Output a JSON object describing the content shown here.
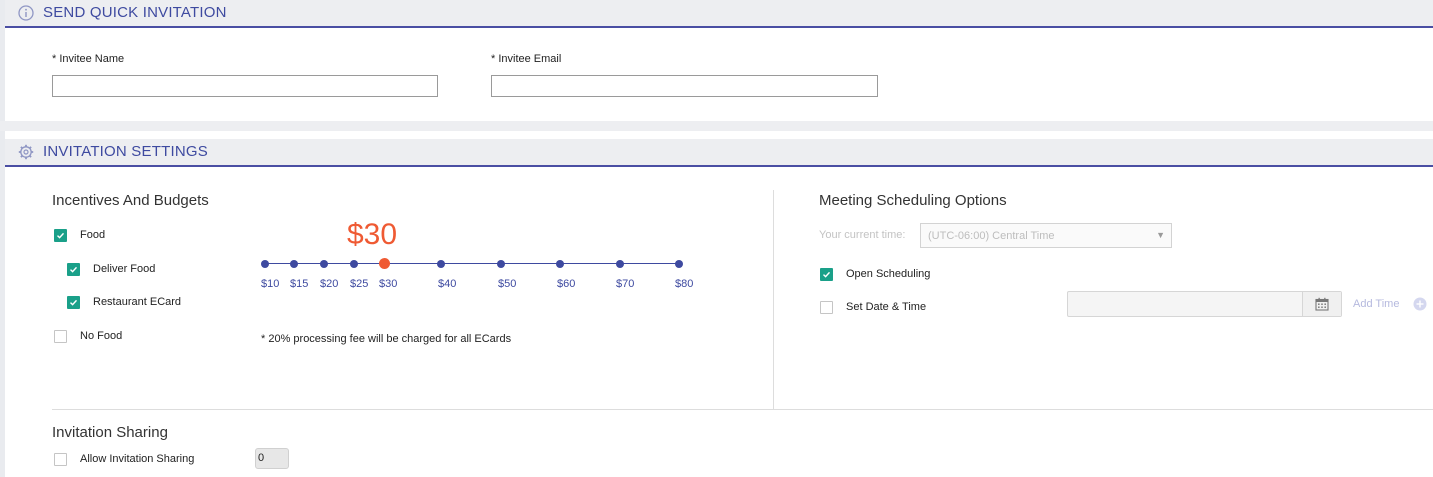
{
  "quick_invitation": {
    "title": "SEND QUICK INVITATION",
    "icon": "info-icon",
    "invitee_name_label": "* Invitee Name",
    "invitee_name_value": "",
    "invitee_email_label": "* Invitee Email",
    "invitee_email_value": ""
  },
  "settings": {
    "title": "INVITATION SETTINGS",
    "icon": "gear-icon"
  },
  "incentives": {
    "heading": "Incentives And Budgets",
    "options": [
      {
        "label": "Food",
        "checked": true
      },
      {
        "label": "Deliver Food",
        "checked": true
      },
      {
        "label": "Restaurant ECard",
        "checked": true
      },
      {
        "label": "No Food",
        "checked": false
      }
    ],
    "budget": {
      "selected_display": "$30",
      "selected_value": 30,
      "ticks": [
        "$10",
        "$15",
        "$20",
        "$25",
        "$30",
        "$40",
        "$50",
        "$60",
        "$70",
        "$80"
      ]
    },
    "note": "* 20% processing fee will be charged for all ECards"
  },
  "meeting": {
    "heading": "Meeting Scheduling Options",
    "current_time_label": "Your current time:",
    "timezone_selected": "(UTC-06:00) Central Time",
    "open_scheduling": {
      "label": "Open Scheduling",
      "checked": true
    },
    "set_date_time": {
      "label": "Set Date & Time",
      "checked": false
    },
    "date_value": "",
    "add_time_label": "Add Time"
  },
  "sharing": {
    "heading": "Invitation Sharing",
    "allow_label": "Allow Invitation Sharing",
    "allow_checked": false,
    "count_value": "0"
  },
  "colors": {
    "accent": "#3e4aa0",
    "active": "#ef5a33",
    "checkbox": "#1aa089"
  }
}
